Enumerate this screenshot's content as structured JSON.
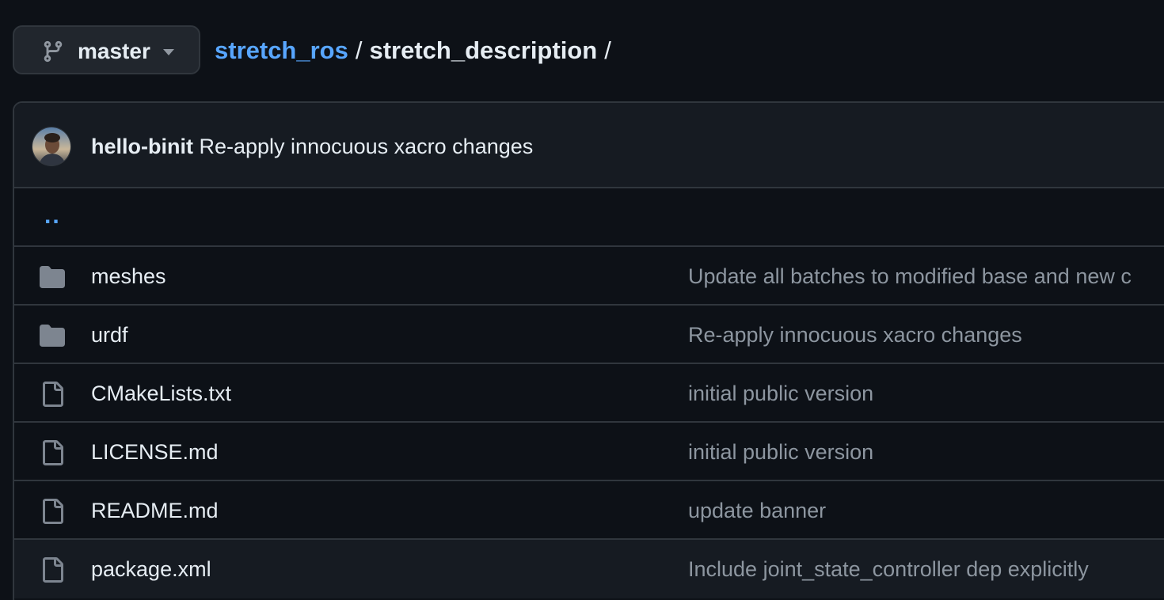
{
  "branch": {
    "icon": "git-branch-icon",
    "name": "master",
    "caret_icon": "triangle-down-icon"
  },
  "breadcrumb": {
    "repo": "stretch_ros",
    "separator": "/",
    "current": "stretch_description",
    "trailing": "/"
  },
  "latest_commit": {
    "author": "hello-binit",
    "message": "Re-apply innocuous xacro changes"
  },
  "parent_link": "..",
  "files": [
    {
      "type": "directory",
      "icon": "folder-icon",
      "name": "meshes",
      "commit": "Update all batches to modified base and new c"
    },
    {
      "type": "directory",
      "icon": "folder-icon",
      "name": "urdf",
      "commit": "Re-apply innocuous xacro changes"
    },
    {
      "type": "file",
      "icon": "file-icon",
      "name": "CMakeLists.txt",
      "commit": "initial public version"
    },
    {
      "type": "file",
      "icon": "file-icon",
      "name": "LICENSE.md",
      "commit": "initial public version"
    },
    {
      "type": "file",
      "icon": "file-icon",
      "name": "README.md",
      "commit": "update banner"
    },
    {
      "type": "file",
      "icon": "file-icon",
      "name": "package.xml",
      "commit": "Include joint_state_controller dep explicitly"
    }
  ],
  "colors": {
    "background": "#0d1117",
    "link": "#58a6ff",
    "muted_text": "#8d96a0",
    "icon_gray": "#7d8590",
    "border": "#30363d"
  }
}
